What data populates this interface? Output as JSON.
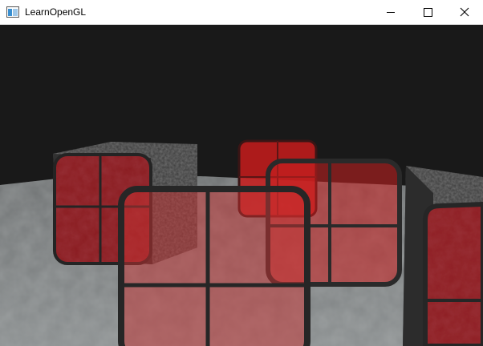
{
  "window": {
    "title": "LearnOpenGL",
    "controls": {
      "minimize": "minimize-icon",
      "maximize": "maximize-icon",
      "close": "close-icon"
    }
  },
  "scene": {
    "description_free": true,
    "background_color": "#191919",
    "floor_color": "#7a7d7d",
    "stone_color": "#3d3d3d",
    "marble_color": "#8e1d22",
    "glass_color": "#e62a2a",
    "frame_color": "#2a2a2a"
  }
}
